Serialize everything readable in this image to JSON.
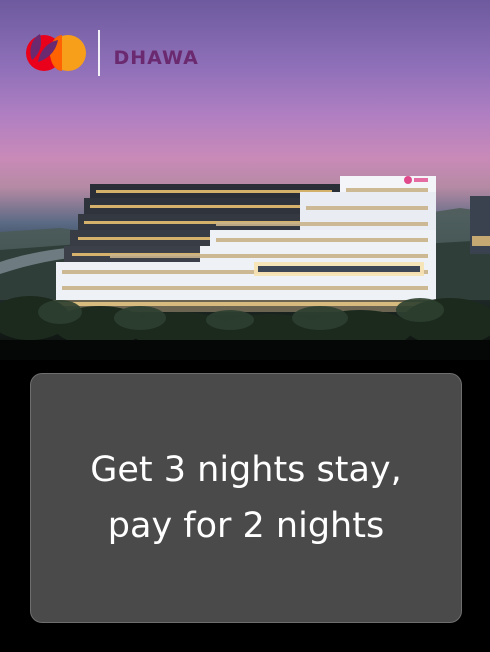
{
  "hero": {
    "image_description_icon": "hotel-building-photo"
  },
  "brand": {
    "partner_logo_icon": "mastercard-logo-icon",
    "hotel_logo_icon": "dhawa-leaf-icon",
    "hotel_name": "DHAWA"
  },
  "offer": {
    "line1": "Get 3 nights stay,",
    "line2": "pay for 2 nights"
  },
  "colors": {
    "card_bg": "#4a4a4a",
    "page_bg": "#000000",
    "mastercard_red": "#eb001b",
    "mastercard_yellow": "#f79e1b",
    "dhawa_purple": "#6b2a6f"
  }
}
